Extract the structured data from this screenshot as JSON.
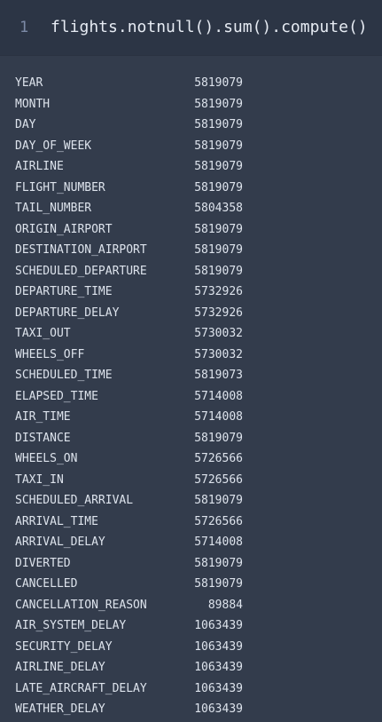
{
  "code_cell": {
    "line_number": "1",
    "code": "flights.notnull().sum().compute()"
  },
  "output": {
    "rows": [
      {
        "name": "YEAR",
        "count": "5819079"
      },
      {
        "name": "MONTH",
        "count": "5819079"
      },
      {
        "name": "DAY",
        "count": "5819079"
      },
      {
        "name": "DAY_OF_WEEK",
        "count": "5819079"
      },
      {
        "name": "AIRLINE",
        "count": "5819079"
      },
      {
        "name": "FLIGHT_NUMBER",
        "count": "5819079"
      },
      {
        "name": "TAIL_NUMBER",
        "count": "5804358"
      },
      {
        "name": "ORIGIN_AIRPORT",
        "count": "5819079"
      },
      {
        "name": "DESTINATION_AIRPORT",
        "count": "5819079"
      },
      {
        "name": "SCHEDULED_DEPARTURE",
        "count": "5819079"
      },
      {
        "name": "DEPARTURE_TIME",
        "count": "5732926"
      },
      {
        "name": "DEPARTURE_DELAY",
        "count": "5732926"
      },
      {
        "name": "TAXI_OUT",
        "count": "5730032"
      },
      {
        "name": "WHEELS_OFF",
        "count": "5730032"
      },
      {
        "name": "SCHEDULED_TIME",
        "count": "5819073"
      },
      {
        "name": "ELAPSED_TIME",
        "count": "5714008"
      },
      {
        "name": "AIR_TIME",
        "count": "5714008"
      },
      {
        "name": "DISTANCE",
        "count": "5819079"
      },
      {
        "name": "WHEELS_ON",
        "count": "5726566"
      },
      {
        "name": "TAXI_IN",
        "count": "5726566"
      },
      {
        "name": "SCHEDULED_ARRIVAL",
        "count": "5819079"
      },
      {
        "name": "ARRIVAL_TIME",
        "count": "5726566"
      },
      {
        "name": "ARRIVAL_DELAY",
        "count": "5714008"
      },
      {
        "name": "DIVERTED",
        "count": "5819079"
      },
      {
        "name": "CANCELLED",
        "count": "5819079"
      },
      {
        "name": "CANCELLATION_REASON",
        "count": "89884"
      },
      {
        "name": "AIR_SYSTEM_DELAY",
        "count": "1063439"
      },
      {
        "name": "SECURITY_DELAY",
        "count": "1063439"
      },
      {
        "name": "AIRLINE_DELAY",
        "count": "1063439"
      },
      {
        "name": "LATE_AIRCRAFT_DELAY",
        "count": "1063439"
      },
      {
        "name": "WEATHER_DELAY",
        "count": "1063439"
      }
    ]
  }
}
